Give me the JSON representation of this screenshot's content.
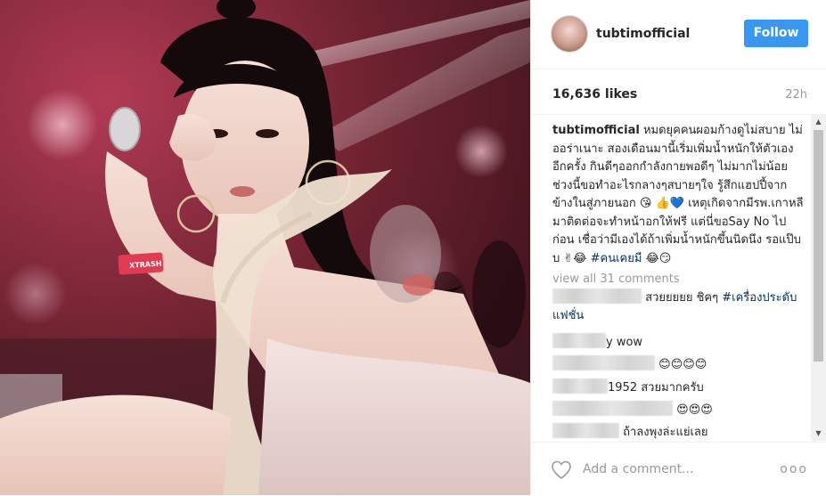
{
  "photo": {
    "wristband_text": "XTRASH"
  },
  "header": {
    "username": "tubtimofficial",
    "follow_label": "Follow"
  },
  "stats": {
    "likes": "16,636 likes",
    "time": "22h"
  },
  "caption": {
    "author": "tubtimofficial",
    "text": "หมดยุคคนผอมก้างดูไม่สบาย ไม่ออร่าเนาะ สองเดือนมานี้เริ่มเพิ่มน้ำหนักให้ตัวเองอีกครั้ง กินดีๆออกกำลังกายพอดีๆ ไม่มากไม่น้อย ช่วงนี้ขอทำอะไรกลางๆสบายๆใจ รู้สึกแฮปปี้จากข้างในสู่ภายนอก 😘 👍💙 เหตุเกิดจากมีรพ.เกาหลีมาติดต่อจะทำหน้าอกให้ฟรี แต่นี่ขอSay No ไปก่อน เชื่อว่ามีเองได้ถ้าเพิ่มน้ำหนักขึ้นนิดนึง รอแป๊บบ ✌😂",
    "hashtag": "#คนเคยมี",
    "end_emoji": "😂😏"
  },
  "view_all": "view all 31 comments",
  "comments": [
    {
      "text": "สวยยยยย ชิคๆ",
      "tag": "#เครื่องประดับแฟชั่น"
    },
    {
      "text": "y wow",
      "tag": ""
    },
    {
      "text": "😊😊😊😊",
      "tag": ""
    },
    {
      "text": "1952 สวยมากครับ",
      "tag": ""
    },
    {
      "text": "😍😍😍",
      "tag": ""
    },
    {
      "text": "ถ้าลงพุงล่ะแย่เลย",
      "tag": ""
    }
  ],
  "footer": {
    "add_comment_placeholder": "Add a comment...",
    "more": "ooo"
  }
}
